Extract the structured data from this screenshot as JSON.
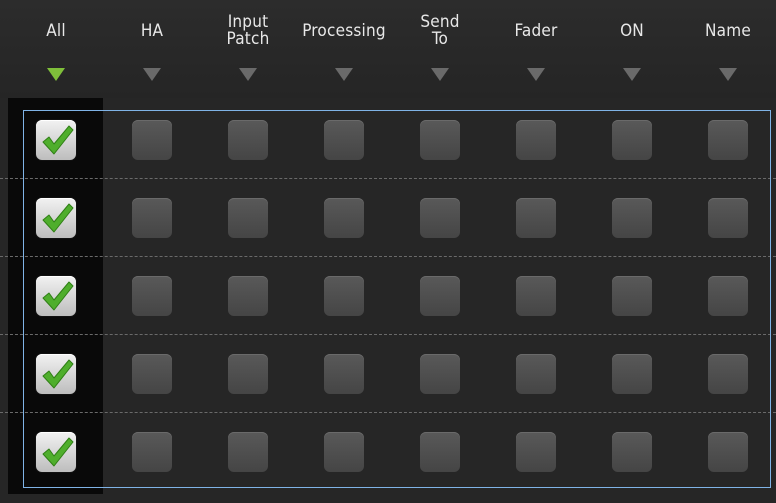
{
  "columns": [
    {
      "label": "All",
      "active": true
    },
    {
      "label": "HA",
      "active": false
    },
    {
      "label": "Input\nPatch",
      "active": false
    },
    {
      "label": "Processing",
      "active": false
    },
    {
      "label": "Send\nTo",
      "active": false
    },
    {
      "label": "Fader",
      "active": false
    },
    {
      "label": "ON",
      "active": false
    },
    {
      "label": "Name",
      "active": false
    }
  ],
  "rows": [
    [
      true,
      false,
      false,
      false,
      false,
      false,
      false,
      false
    ],
    [
      true,
      false,
      false,
      false,
      false,
      false,
      false,
      false
    ],
    [
      true,
      false,
      false,
      false,
      false,
      false,
      false,
      false
    ],
    [
      true,
      false,
      false,
      false,
      false,
      false,
      false,
      false
    ],
    [
      true,
      false,
      false,
      false,
      false,
      false,
      false,
      false
    ]
  ],
  "colors": {
    "active_arrow": "#7fbf3a",
    "inactive_arrow": "#6a6a6a",
    "checkmark": "#4fae2c",
    "selection_border": "#7fb3e6"
  }
}
